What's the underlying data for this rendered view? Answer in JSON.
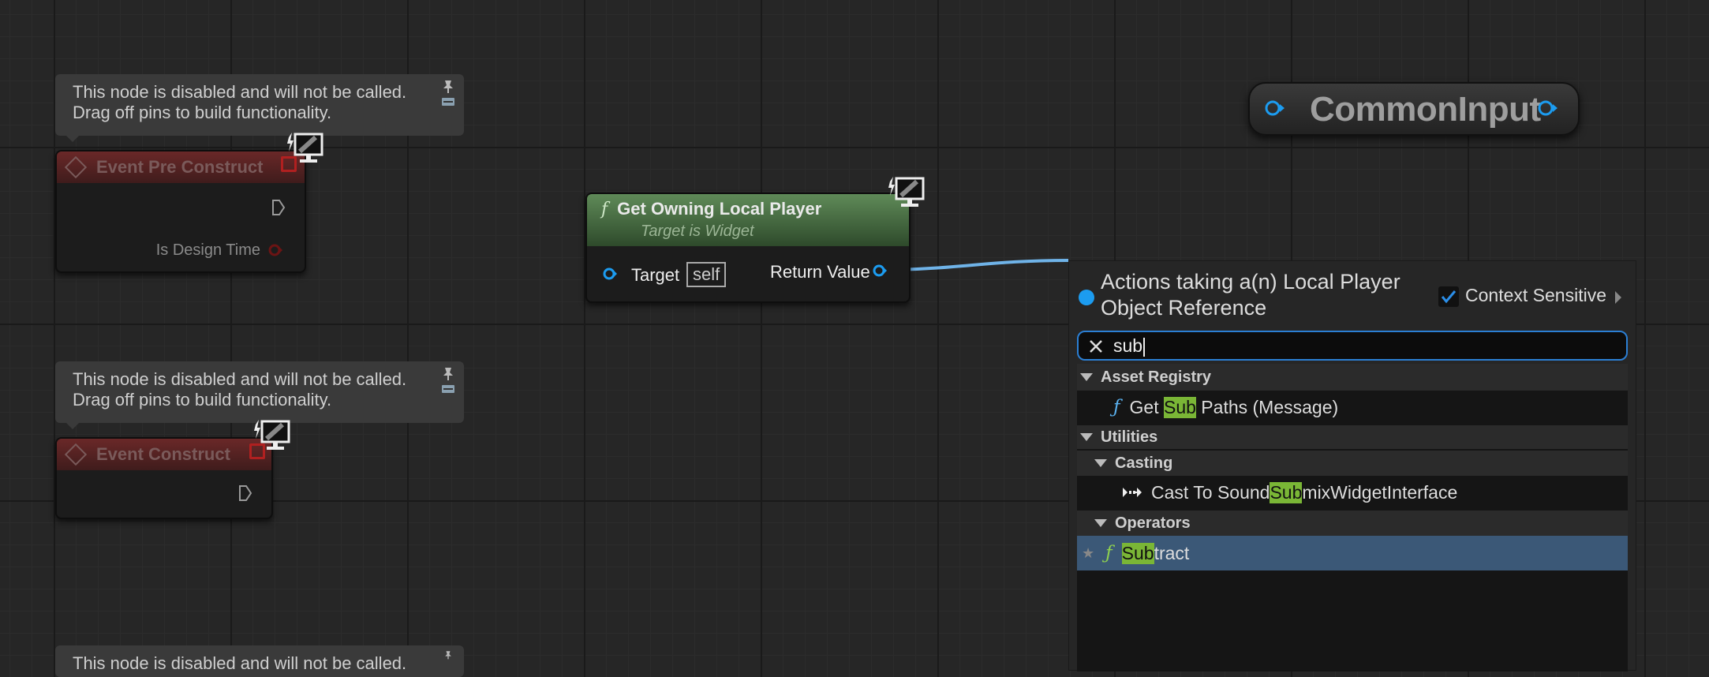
{
  "comments": {
    "c1": {
      "line1": "This node is disabled and will not be called.",
      "line2": "Drag off pins to build functionality."
    },
    "c2": {
      "line1": "This node is disabled and will not be called.",
      "line2": "Drag off pins to build functionality."
    },
    "c3": {
      "line1": "This node is disabled and will not be called."
    }
  },
  "event_pre_construct": {
    "title": "Event Pre Construct",
    "pin_label": "Is Design Time"
  },
  "event_construct": {
    "title": "Event Construct"
  },
  "get_owning": {
    "icon": "f",
    "title": "Get Owning Local Player",
    "subtitle": "Target is Widget",
    "target_label": "Target",
    "target_value": "self",
    "return_label": "Return Value"
  },
  "common_input": {
    "label": "CommonInput"
  },
  "menu": {
    "title": "Actions taking a(n) Local Player Object Reference",
    "context_label": "Context Sensitive",
    "context_checked": true,
    "search_value": "sub",
    "items": {
      "asset_registry": "Asset Registry",
      "get_sub_paths": {
        "pre": "Get ",
        "hl": "Sub",
        "post": " Paths (Message)"
      },
      "utilities": "Utilities",
      "casting": "Casting",
      "cast_to": {
        "pre": "Cast To Sound",
        "hl": "Sub",
        "post": "mixWidgetInterface"
      },
      "operators": "Operators",
      "subtract": {
        "pre": "",
        "hl": "Sub",
        "post": "tract"
      }
    }
  },
  "colors": {
    "accent_blue": "#1c9cf0",
    "highlight_green": "#7ab636",
    "selection": "#3b5877",
    "wire": "#6fb3e8"
  }
}
